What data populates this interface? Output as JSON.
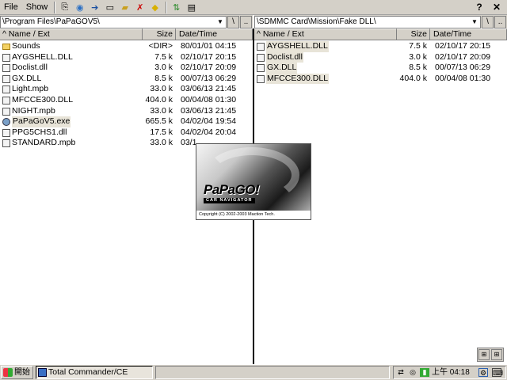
{
  "menu": {
    "file_label": "File",
    "show_label": "Show",
    "toolbar_icons": [
      "copy-icon",
      "refresh-icon",
      "move-icon",
      "rename-icon",
      "new-folder-icon",
      "delete-icon",
      "pack-icon",
      "sync-icon",
      "settings-icon"
    ],
    "help_glyph": "?",
    "ok_glyph": "✕"
  },
  "left_panel": {
    "path": "\\Program Files\\PaPaGOV5\\",
    "btn_root": "\\",
    "btn_up": "..",
    "col_name": "^ Name / Ext",
    "col_size": "Size",
    "col_date": "Date/Time",
    "files": [
      {
        "name": "Sounds",
        "size": "<DIR>",
        "date": "80/01/01 04:15",
        "icon": "folder-icon"
      },
      {
        "name": "AYGSHELL.DLL",
        "size": "7.5 k",
        "date": "02/10/17 20:15",
        "icon": "file-icon"
      },
      {
        "name": "Doclist.dll",
        "size": "3.0 k",
        "date": "02/10/17 20:09",
        "icon": "file-icon"
      },
      {
        "name": "GX.DLL",
        "size": "8.5 k",
        "date": "00/07/13 06:29",
        "icon": "file-icon"
      },
      {
        "name": "Light.mpb",
        "size": "33.0 k",
        "date": "03/06/13 21:45",
        "icon": "file-icon"
      },
      {
        "name": "MFCCE300.DLL",
        "size": "404.0 k",
        "date": "00/04/08 01:30",
        "icon": "file-icon"
      },
      {
        "name": "NIGHT.mpb",
        "size": "33.0 k",
        "date": "03/06/13 21:45",
        "icon": "file-icon"
      },
      {
        "name": "PaPaGoV5.exe",
        "size": "665.5 k",
        "date": "04/02/04 19:54",
        "icon": "exe-icon",
        "selected": true
      },
      {
        "name": "PPG5CHS1.dll",
        "size": "17.5 k",
        "date": "04/02/04 20:04",
        "icon": "file-icon"
      },
      {
        "name": "STANDARD.mpb",
        "size": "33.0 k",
        "date": "03/1",
        "icon": "file-icon"
      }
    ]
  },
  "right_panel": {
    "path": "\\SDMMC Card\\Mission\\Fake DLL\\",
    "btn_root": "\\",
    "btn_up": "..",
    "col_name": "^ Name / Ext",
    "col_size": "Size",
    "col_date": "Date/Time",
    "files": [
      {
        "name": "AYGSHELL.DLL",
        "size": "7.5 k",
        "date": "02/10/17 20:15",
        "icon": "file-icon",
        "selected": true
      },
      {
        "name": "Doclist.dll",
        "size": "3.0 k",
        "date": "02/10/17 20:09",
        "icon": "file-icon",
        "selected": true
      },
      {
        "name": "GX.DLL",
        "size": "8.5 k",
        "date": "00/07/13 06:29",
        "icon": "file-icon",
        "selected": true
      },
      {
        "name": "MFCCE300.DLL",
        "size": "404.0 k",
        "date": "00/04/08 01:30",
        "icon": "file-icon",
        "selected": true
      }
    ]
  },
  "splash": {
    "logo": "PaPaGO!",
    "subtitle": "CAR NAVIGATOR",
    "copyright": "Copyright (C) 2002-2003 Maction Tech."
  },
  "taskbar": {
    "start_label": "開始",
    "task_label": "Total Commander/CE",
    "clock": "上午 04:18"
  }
}
